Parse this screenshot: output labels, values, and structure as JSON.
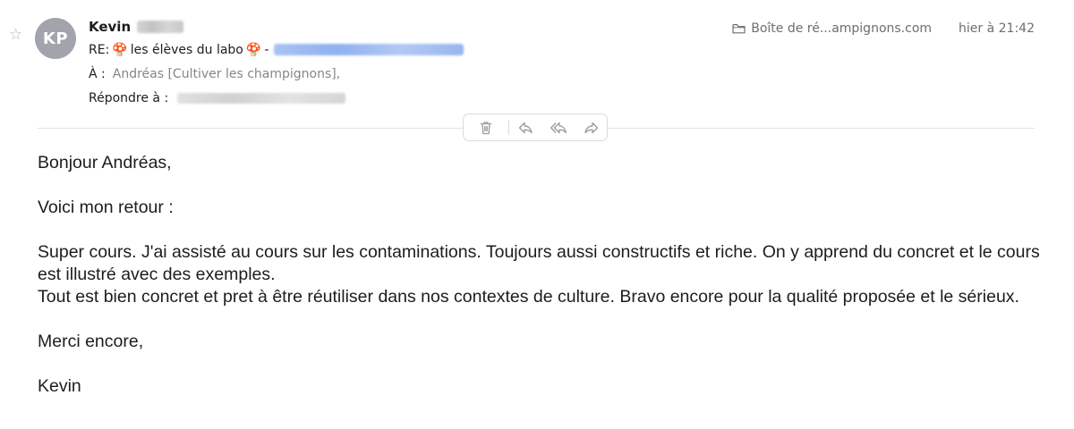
{
  "header": {
    "sender_name": "Kevin",
    "avatar_initials": "KP",
    "subject_prefix": "RE:",
    "subject_mushroom_left": "🍄",
    "subject_text": "les élèves du labo",
    "subject_mushroom_right": "🍄",
    "subject_dash": "-",
    "to_label": "À :",
    "to_value": "Andréas [Cultiver les champignons],",
    "reply_to_label": "Répondre à :",
    "mailbox": "Boîte de ré...ampignons.com",
    "time": "hier à 21:42"
  },
  "icons": {
    "star": "star-icon",
    "folder": "folder-icon",
    "trash": "trash-icon",
    "reply": "reply-icon",
    "reply_all": "reply-all-icon",
    "forward": "forward-icon"
  },
  "colors": {
    "avatar_bg": "#a1a4aa",
    "secondary_text": "#86868b",
    "icon_gray": "#9a9a9a"
  },
  "body": {
    "greeting": "Bonjour Andréas,",
    "intro": "Voici mon retour :",
    "paragraph_line1": "Super cours. J'ai assisté au cours sur les contaminations. Toujours aussi constructifs et riche. On y apprend du concret et le cours est illustré avec des exemples.",
    "paragraph_line2": "Tout est bien concret et pret à être réutiliser dans nos contextes de culture. Bravo encore pour la qualité proposée et le sérieux.",
    "closing": "Merci encore,",
    "signature": "Kevin"
  }
}
